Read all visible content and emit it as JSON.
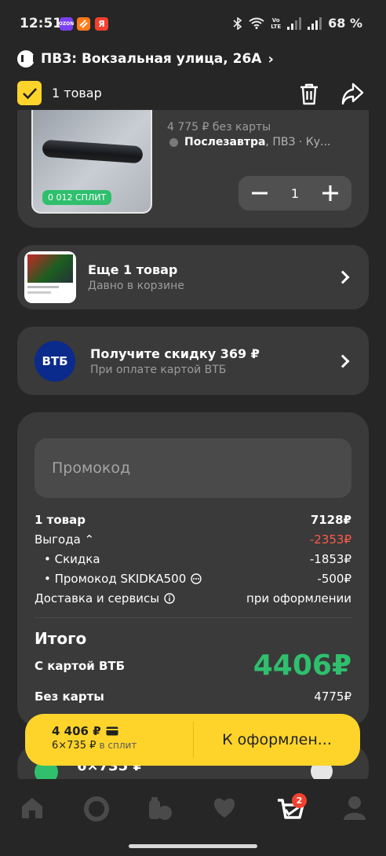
{
  "status_bar": {
    "time": "12:51",
    "badge1": "OZON",
    "network_top": "Vo",
    "network_bottom": "LTE",
    "battery": "68 %"
  },
  "header": {
    "address": "ПВЗ: Вокзальная улица, 26А",
    "chevron": "›",
    "select_label": "1 товар"
  },
  "product": {
    "split_tag": "0 012 СПЛИТ",
    "price_no_card": "4 775 ₽ без карты",
    "delivery_bold": "Послезавтра",
    "delivery_rest": ", ПВЗ · Ку...",
    "quantity": "1"
  },
  "more_item": {
    "title": "Еще 1 товар",
    "subtitle": "Давно в корзине"
  },
  "vtb_offer": {
    "logo": "ВТБ",
    "title": "Получите скидку 369 ₽",
    "subtitle": "При оплате картой ВТБ"
  },
  "summary": {
    "promo_placeholder": "Промокод",
    "items_label": "1 товар",
    "items_value": "7128₽",
    "benefit_label": "Выгода ⌃",
    "benefit_value": "-2353₽",
    "discount_label": "•  Скидка",
    "discount_value": "-1853₽",
    "promo_label": "•  Промокод SKIDKA500",
    "promo_value": "-500₽",
    "delivery_label": "Доставка и сервисы",
    "delivery_value": "при оформлении",
    "total_title": "Итого",
    "vtb_label": "С картой ВТБ",
    "vtb_total": "4406₽",
    "nocard_label": "Без карты",
    "nocard_total": "4775₽"
  },
  "buy_bar": {
    "price": "4 406 ₽",
    "split": "6×735 ₽",
    "split_suffix": "в сплит",
    "checkout": "К оформлен..."
  },
  "peek": {
    "text": "6×735 ₽"
  },
  "tabbar": {
    "cart_badge": "2"
  },
  "colors": {
    "accent_yellow": "#fed42b",
    "green": "#2fbf6d",
    "red": "#ff5a4a",
    "vtb_blue": "#0a2a8c"
  }
}
